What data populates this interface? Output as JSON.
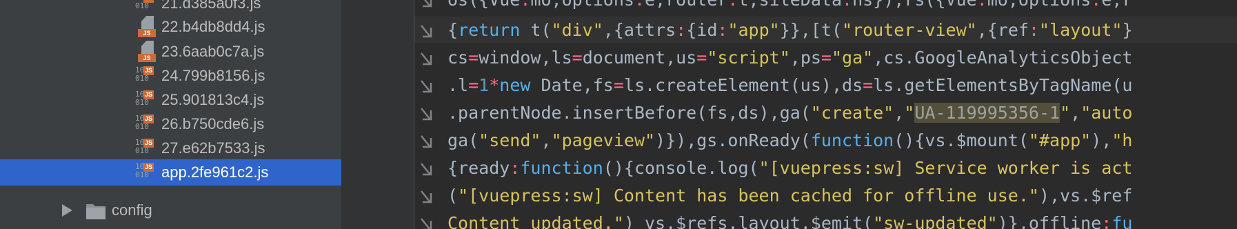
{
  "tree": {
    "items": [
      {
        "name": "21.d385a0f3.js",
        "icon": "binary-js-file-icon",
        "selected": false
      },
      {
        "name": "22.b4db8dd4.js",
        "icon": "js-file-icon",
        "selected": false
      },
      {
        "name": "23.6aab0c7a.js",
        "icon": "js-file-icon",
        "selected": false
      },
      {
        "name": "24.799b8156.js",
        "icon": "binary-js-file-icon",
        "selected": false
      },
      {
        "name": "25.901813c4.js",
        "icon": "binary-js-file-icon",
        "selected": false
      },
      {
        "name": "26.b750cde6.js",
        "icon": "binary-js-file-icon",
        "selected": false
      },
      {
        "name": "27.e62b7533.js",
        "icon": "binary-js-file-icon",
        "selected": false
      },
      {
        "name": "app.2fe961c2.js",
        "icon": "binary-js-file-icon",
        "selected": true
      }
    ],
    "folder": {
      "name": "config",
      "icon": "folder-icon",
      "expand_icon": "expand-arrow-icon"
    }
  },
  "icon_text": {
    "bin_top": "10",
    "bin_bottom": "010",
    "js": "JS"
  },
  "editor": {
    "wrap_icon": "soft-wrap-icon",
    "lines": [
      [
        [
          "p",
          "os({Vue"
        ],
        [
          "o",
          ":"
        ],
        [
          "p",
          "mo,options"
        ],
        [
          "o",
          ":"
        ],
        [
          "p",
          "e,router"
        ],
        [
          "o",
          ":"
        ],
        [
          "p",
          "t,siteData"
        ],
        [
          "o",
          ":"
        ],
        [
          "p",
          "ns}),rs({Vue"
        ],
        [
          "o",
          ":"
        ],
        [
          "p",
          "mo,options"
        ],
        [
          "o",
          ":"
        ],
        [
          "p",
          "e,r"
        ]
      ],
      [
        [
          "p",
          "{"
        ],
        [
          "k",
          "return"
        ],
        [
          "p",
          " t("
        ],
        [
          "s",
          "\"div\""
        ],
        [
          "p",
          ",{attrs"
        ],
        [
          "o",
          ":"
        ],
        [
          "p",
          "{id"
        ],
        [
          "o",
          ":"
        ],
        [
          "s",
          "\"app\""
        ],
        [
          "p",
          "}},[t("
        ],
        [
          "s",
          "\"router-view\""
        ],
        [
          "p",
          ",{ref"
        ],
        [
          "o",
          ":"
        ],
        [
          "s",
          "\"layout\""
        ],
        [
          "p",
          "}"
        ]
      ],
      [
        [
          "p",
          "cs"
        ],
        [
          "o",
          "="
        ],
        [
          "p",
          "window,ls"
        ],
        [
          "o",
          "="
        ],
        [
          "p",
          "document,us"
        ],
        [
          "o",
          "="
        ],
        [
          "s",
          "\"script\""
        ],
        [
          "p",
          ",ps"
        ],
        [
          "o",
          "="
        ],
        [
          "s",
          "\"ga\""
        ],
        [
          "p",
          ",cs.GoogleAnalyticsObject"
        ]
      ],
      [
        [
          "p",
          ".l"
        ],
        [
          "o",
          "="
        ],
        [
          "n",
          "1"
        ],
        [
          "o",
          "*"
        ],
        [
          "k",
          "new"
        ],
        [
          "p",
          " Date,fs"
        ],
        [
          "o",
          "="
        ],
        [
          "p",
          "ls.createElement(us),ds"
        ],
        [
          "o",
          "="
        ],
        [
          "p",
          "ls.getElementsByTagName(u"
        ]
      ],
      [
        [
          "p",
          ".parentNode.insertBefore(fs,ds),ga("
        ],
        [
          "s",
          "\"create\""
        ],
        [
          "p",
          ","
        ],
        [
          "s",
          "\""
        ],
        [
          "h",
          "UA-119995356-1"
        ],
        [
          "s",
          "\""
        ],
        [
          "p",
          ","
        ],
        [
          "s",
          "\"auto"
        ]
      ],
      [
        [
          "p",
          "ga("
        ],
        [
          "s",
          "\"send\""
        ],
        [
          "p",
          ","
        ],
        [
          "s",
          "\"pageview\""
        ],
        [
          "p",
          ")}),gs.onReady("
        ],
        [
          "k",
          "function"
        ],
        [
          "p",
          "(){vs.$mount("
        ],
        [
          "s",
          "\"#app\""
        ],
        [
          "p",
          "),"
        ],
        [
          "s",
          "\"h"
        ]
      ],
      [
        [
          "p",
          "{ready"
        ],
        [
          "o",
          ":"
        ],
        [
          "k",
          "function"
        ],
        [
          "p",
          "(){console.log("
        ],
        [
          "s",
          "\"[vuepress:sw] Service worker is act"
        ]
      ],
      [
        [
          "p",
          "("
        ],
        [
          "s",
          "\"[vuepress:sw] Content has been cached for offline use.\""
        ],
        [
          "p",
          "),vs.$ref"
        ]
      ],
      [
        [
          "s",
          "Content updated.\""
        ],
        [
          "p",
          ") vs.$refs.layout.$emit("
        ],
        [
          "s",
          "\"sw-updated\""
        ],
        [
          "p",
          ")},offline"
        ],
        [
          "o",
          ":"
        ],
        [
          "k",
          "fu"
        ]
      ]
    ]
  },
  "colors": {
    "tree_bg": "#3c3f41",
    "selection": "#2f65ca",
    "editor_bg": "#2b2b2b",
    "gutter_bg": "#313335",
    "punct": "#a9b7c6",
    "operator": "#ff6b8b",
    "string": "#d7c35f",
    "keyword": "#59aee8",
    "number": "#6897bb",
    "highlight": "#52503a"
  }
}
